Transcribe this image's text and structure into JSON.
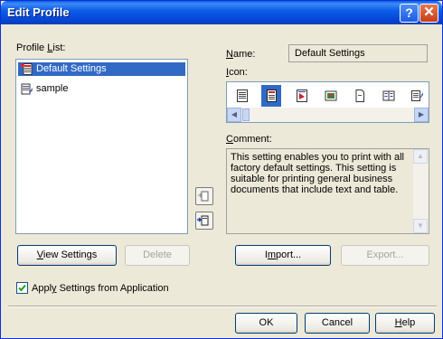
{
  "window": {
    "title": "Edit Profile",
    "help_glyph": "?",
    "close_glyph": "✕"
  },
  "profile_list": {
    "label_pre": "Profile ",
    "label_ul": "L",
    "label_post": "ist:",
    "items": [
      {
        "label": "Default Settings",
        "selected": true,
        "icon": "default-profile-icon"
      },
      {
        "label": "sample",
        "selected": false,
        "icon": "sample-profile-icon"
      }
    ]
  },
  "name": {
    "label_ul": "N",
    "label_post": "ame:",
    "value": "Default Settings"
  },
  "icon_picker": {
    "label_ul": "I",
    "label_post": "con:",
    "icons": [
      "document-icon",
      "document-red-icon",
      "print-layout-icon",
      "image-icon",
      "page-icon",
      "two-page-icon",
      "notepad-icon"
    ],
    "selected_index": 1
  },
  "comment": {
    "label_ul": "C",
    "label_post": "omment:",
    "text": "This setting enables you to print with all factory default settings. This setting is suitable for printing general business documents that include text and table."
  },
  "buttons": {
    "view_settings_ul": "V",
    "view_settings_post": "iew Settings",
    "delete": "Delete",
    "import_pre": "I",
    "import_ul": "m",
    "import_post": "port...",
    "export": "Export...",
    "ok": "OK",
    "cancel": "Cancel",
    "help_ul": "H",
    "help_post": "elp"
  },
  "apply_checkbox": {
    "pre": "Appl",
    "ul": "y",
    "post": " Settings from Application",
    "checked": true
  },
  "colors": {
    "selection": "#316ac5",
    "titlebar": "#0546d6",
    "dialog_bg": "#ece9d8"
  }
}
